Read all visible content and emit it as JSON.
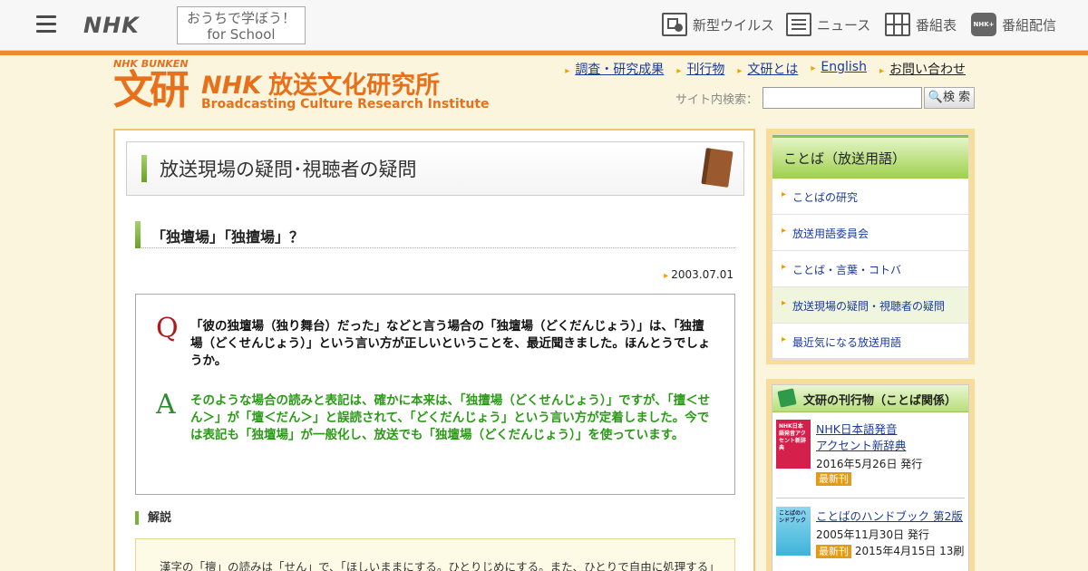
{
  "topbar": {
    "logo": "NHK",
    "school_line1": "おうちで学ぼう！",
    "school_line2": "for School",
    "nav": [
      {
        "label": "新型ウイルス",
        "icon": "virus-news-icon"
      },
      {
        "label": "ニュース",
        "icon": "news-icon"
      },
      {
        "label": "番組表",
        "icon": "program-guide-icon"
      },
      {
        "label": "番組配信",
        "icon": "nhk-plus-icon"
      }
    ],
    "nhk_plus_mark": "NHK+"
  },
  "site": {
    "bunken_small": "NHK BUNKEN",
    "bunken_kanji": "文研",
    "title_nhk": "NHK",
    "title_jp": "放送文化研究所",
    "title_en": "Broadcasting Culture Research Institute"
  },
  "header_links": [
    "調査・研究成果",
    "刊行物",
    "文研とは",
    "English",
    "お問い合わせ"
  ],
  "search": {
    "label": "サイト内検索：",
    "placeholder": "",
    "button": "検 索"
  },
  "section": {
    "title": "放送現場の疑問･視聴者の疑問"
  },
  "article": {
    "title": "「独壇場」「独擅場」？",
    "date": "2003.07.01",
    "q_mark": "Q",
    "question": "「彼の独壇場（独り舞台）だった」などと言う場合の「独壇場（どくだんじょう）」は、「独擅場（どくせんじょう）」という言い方が正しいということを、最近聞きました。ほんとうでしょうか。",
    "a_mark": "A",
    "answer": "そのような場合の読みと表記は、確かに本来は、「独擅場（どくせんじょう）」ですが、「擅＜せん＞」が「壇＜だん＞」と誤読されて、「どくだんじょう」という言い方が定着しました。今では表記も「独壇場」が一般化し、放送でも「独壇場（どくだんじょう）」を使っています。",
    "explanation_heading": "解説",
    "explanation": "漢字の「擅」の読みは「せん」で、「ほしいままにする。ひとりじめにする。また、ひとりで自由に処理する」"
  },
  "sidebar": {
    "heading": "ことば（放送用語）",
    "items": [
      {
        "label": "ことばの研究"
      },
      {
        "label": "放送用語委員会"
      },
      {
        "label": "ことば・言葉・コトバ"
      },
      {
        "label": "放送現場の疑問・視聴者の疑問"
      },
      {
        "label": "最近気になる放送用語"
      }
    ]
  },
  "publications": {
    "heading": "文研の刊行物（ことば関係）",
    "books": [
      {
        "title_line1": "NHK日本語発音",
        "title_line2": "アクセント新辞典",
        "date": "2016年5月26日 発行",
        "badge": "最新刊",
        "extra": "",
        "cover_text": "NHK日本語発音アクセント新辞典"
      },
      {
        "title_line1": "ことばのハンドブック 第2版",
        "title_line2": "",
        "date": "2005年11月30日 発行",
        "badge": "最新刊",
        "extra": "2015年4月15日 13刷",
        "cover_text": "ことばのハンドブック"
      }
    ]
  },
  "colors": {
    "accent_orange": "#f08a2c",
    "link_blue": "#1a3a9a",
    "answer_green": "#2a9a16",
    "question_red": "#b01a1a"
  }
}
